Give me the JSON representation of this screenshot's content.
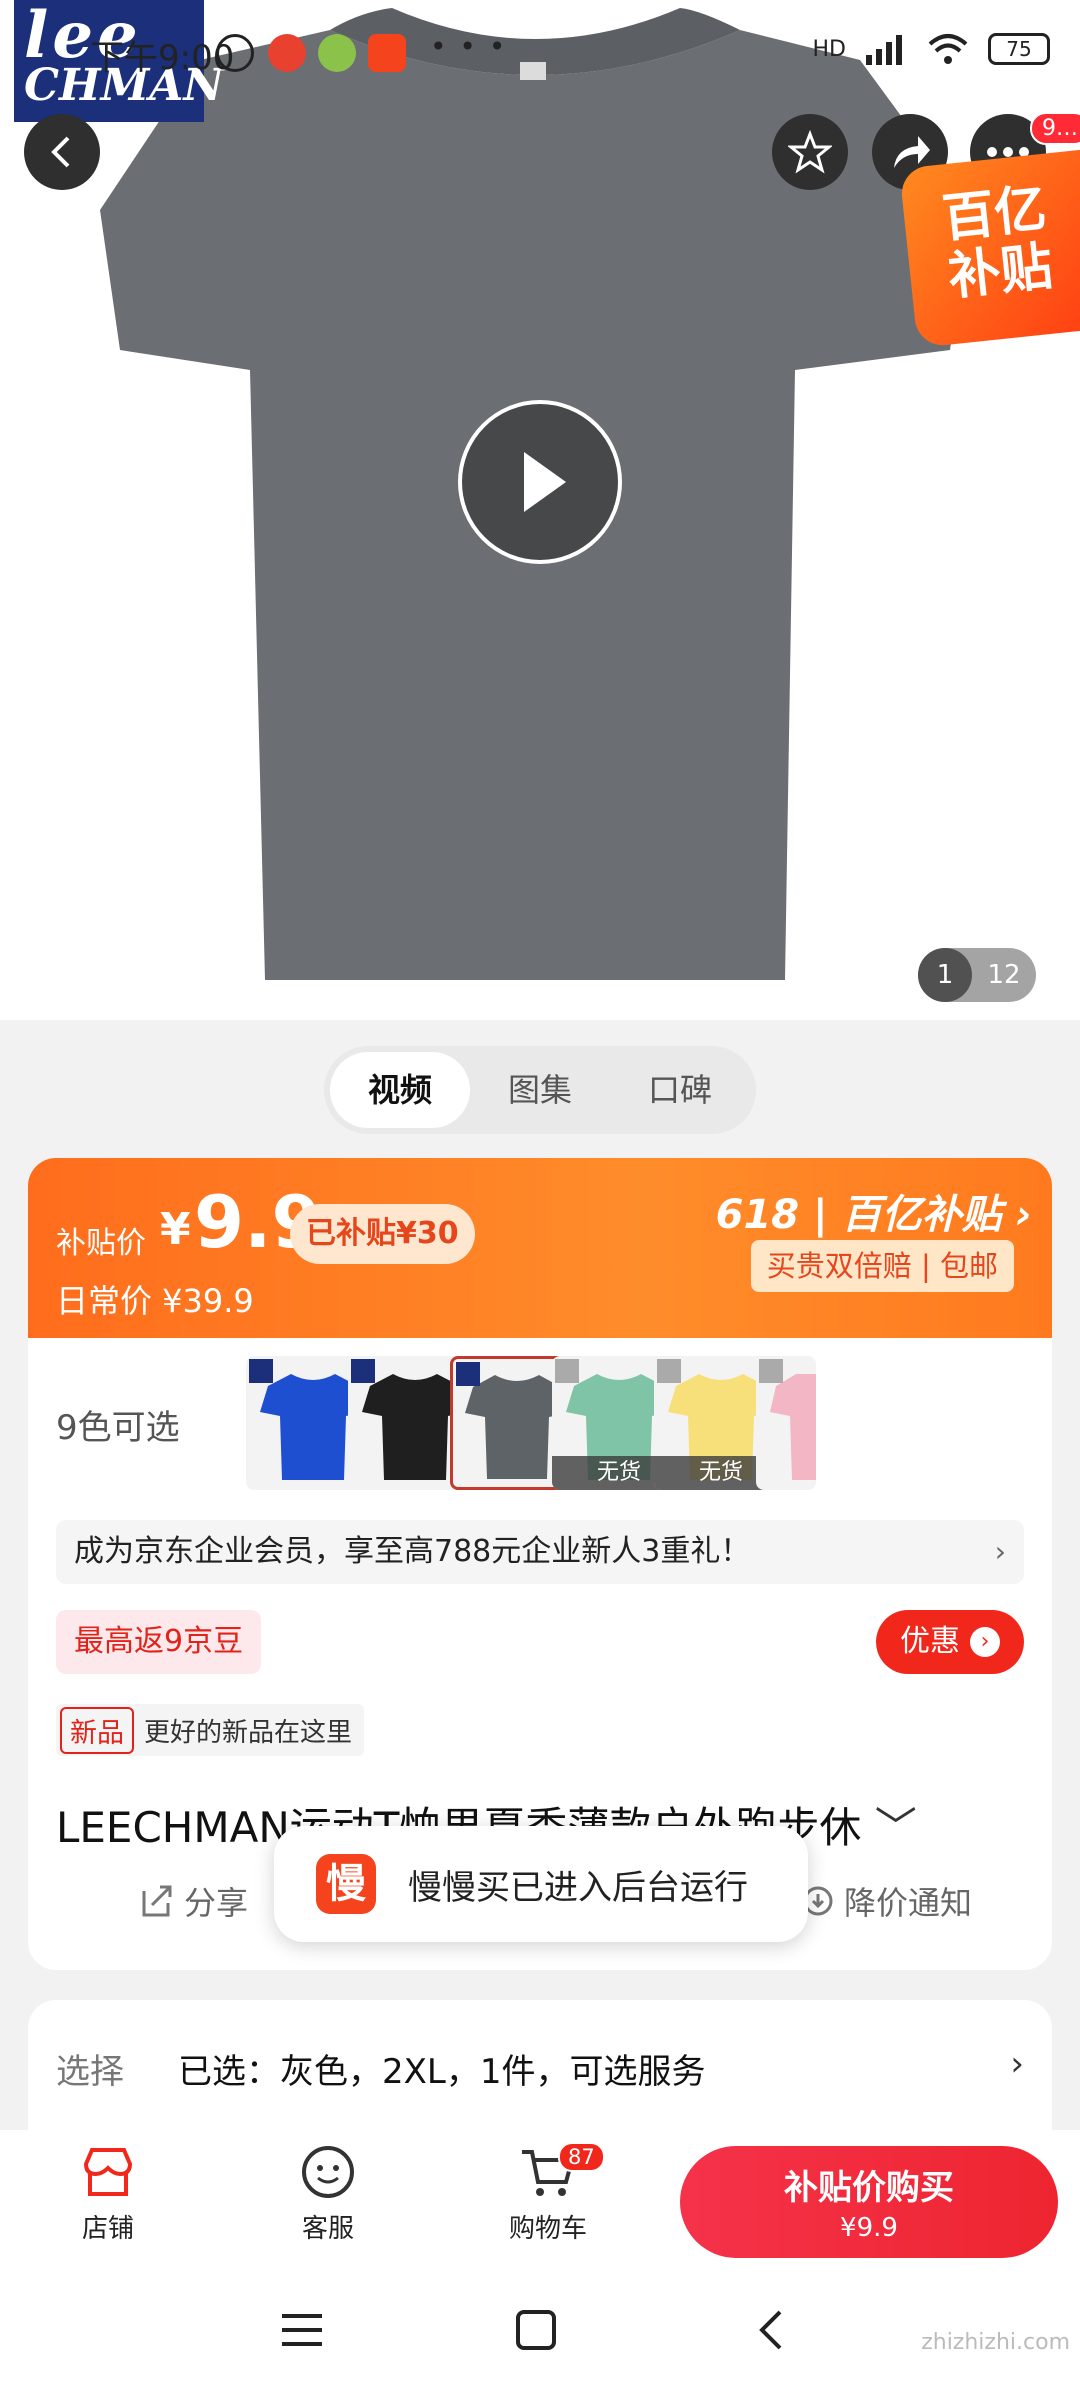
{
  "status_bar": {
    "time": "下午9:00",
    "dots": "• • •",
    "right_label": "HD",
    "battery": "75"
  },
  "brand_logo": {
    "line1": "lee",
    "line2": "CHMAN"
  },
  "hero": {
    "more_badge": "9…",
    "subsidy_tag_line1": "百亿",
    "subsidy_tag_line2": "补贴",
    "page_current": "1",
    "page_total": "12"
  },
  "media_tabs": [
    {
      "label": "视频",
      "active": true
    },
    {
      "label": "图集",
      "active": false
    },
    {
      "label": "口碑",
      "active": false
    }
  ],
  "price": {
    "label": "补贴价",
    "currency": "¥",
    "value": "9.9",
    "subsidy_cut": "已补贴¥30",
    "daily_label": "日常价 ¥39.9",
    "promo": "618 | 百亿补贴 ›",
    "guarantee": "买贵双倍赔 | 包邮"
  },
  "colors": {
    "label": "9色可选",
    "items": [
      {
        "name": "blue",
        "color": "#1f4fd1",
        "sold_out": ""
      },
      {
        "name": "black",
        "color": "#1f1f1f",
        "sold_out": ""
      },
      {
        "name": "gray",
        "color": "#5d6367",
        "sold_out": "",
        "selected": true
      },
      {
        "name": "mint",
        "color": "#7fc4a6",
        "sold_out": "无货"
      },
      {
        "name": "yellow",
        "color": "#f7e07a",
        "sold_out": "无货"
      }
    ]
  },
  "member_banner": "成为京东企业会员，享至高788元企业新人3重礼！",
  "jd_bean": "最高返9京豆",
  "coupon": {
    "label": "优惠"
  },
  "new_product": {
    "tag": "新品",
    "text": "更好的新品在这里"
  },
  "product_title": "LEECHMAN运动T恤男夏季薄款户外跑步休",
  "actions": {
    "share": "分享",
    "price_alert": "降价通知"
  },
  "toast": {
    "icon_char": "慢",
    "message": "慢慢买已进入后台运行"
  },
  "selection": {
    "key": "选择",
    "value": "已选：灰色，2XL，1件，可选服务"
  },
  "bottom_bar": {
    "store": "店铺",
    "service": "客服",
    "cart": "购物车",
    "cart_count": "87",
    "buy_label": "补贴价购买",
    "buy_price": "¥9.9"
  },
  "watermark": "zhizhizhi.com",
  "theme": {
    "accent": "#f2271b",
    "orange": "#ff7a1e",
    "shirt": "#6a6e72"
  }
}
